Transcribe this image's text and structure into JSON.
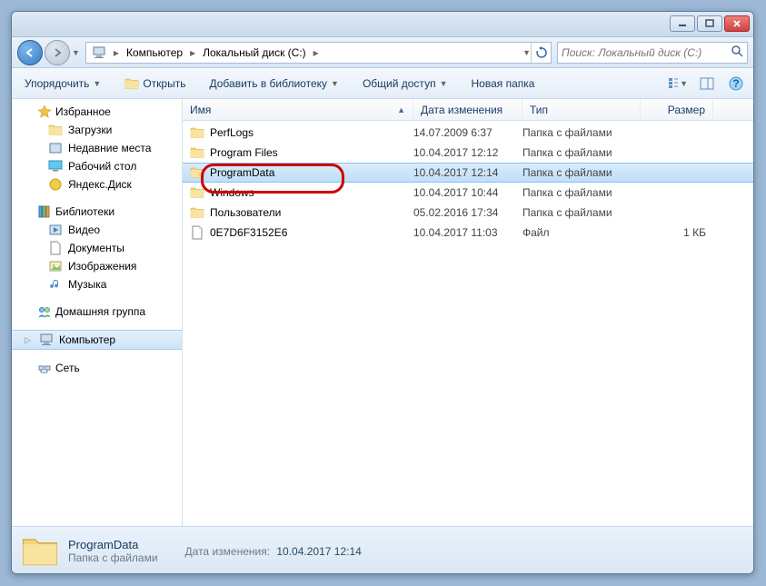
{
  "titlebar": {},
  "nav": {
    "breadcrumb": [
      "Компьютер",
      "Локальный диск (C:)"
    ],
    "search_placeholder": "Поиск: Локальный диск (C:)"
  },
  "toolbar": {
    "organize": "Упорядочить",
    "open": "Открыть",
    "library": "Добавить в библиотеку",
    "share": "Общий доступ",
    "newfolder": "Новая папка"
  },
  "sidebar": {
    "favorites": {
      "label": "Избранное",
      "items": [
        "Загрузки",
        "Недавние места",
        "Рабочий стол",
        "Яндекс.Диск"
      ]
    },
    "libraries": {
      "label": "Библиотеки",
      "items": [
        "Видео",
        "Документы",
        "Изображения",
        "Музыка"
      ]
    },
    "homegroup": {
      "label": "Домашняя группа"
    },
    "computer": {
      "label": "Компьютер"
    },
    "network": {
      "label": "Сеть"
    }
  },
  "columns": {
    "name": "Имя",
    "date": "Дата изменения",
    "type": "Тип",
    "size": "Размер"
  },
  "files": [
    {
      "icon": "folder",
      "name": "PerfLogs",
      "date": "14.07.2009 6:37",
      "type": "Папка с файлами",
      "size": ""
    },
    {
      "icon": "folder",
      "name": "Program Files",
      "date": "10.04.2017 12:12",
      "type": "Папка с файлами",
      "size": ""
    },
    {
      "icon": "folder",
      "name": "ProgramData",
      "date": "10.04.2017 12:14",
      "type": "Папка с файлами",
      "size": "",
      "selected": true,
      "highlight": true
    },
    {
      "icon": "folder",
      "name": "Windows",
      "date": "10.04.2017 10:44",
      "type": "Папка с файлами",
      "size": ""
    },
    {
      "icon": "folder",
      "name": "Пользователи",
      "date": "05.02.2016 17:34",
      "type": "Папка с файлами",
      "size": ""
    },
    {
      "icon": "file",
      "name": "0E7D6F3152E6",
      "date": "10.04.2017 11:03",
      "type": "Файл",
      "size": "1 КБ"
    }
  ],
  "details": {
    "name": "ProgramData",
    "type": "Папка с файлами",
    "date_label": "Дата изменения:",
    "date": "10.04.2017 12:14"
  }
}
